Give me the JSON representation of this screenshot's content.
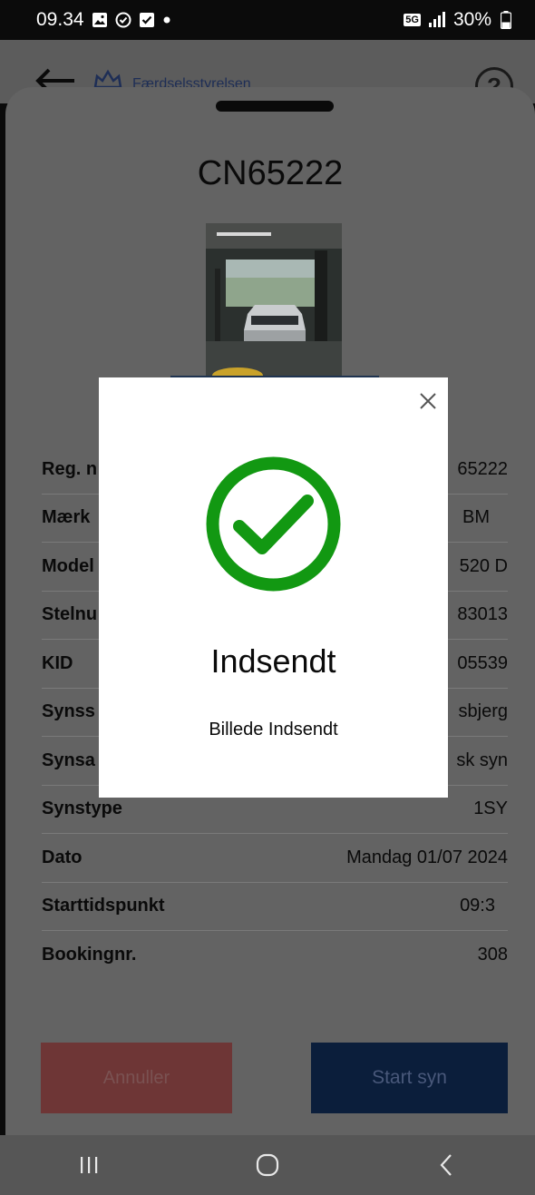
{
  "status_bar": {
    "time": "09.34",
    "network": "5G",
    "battery": "30%"
  },
  "header": {
    "agency": "Færdselsstyrelsen",
    "help": "?"
  },
  "vehicle": {
    "registration": "CN65222"
  },
  "details": [
    {
      "label": "Reg. n",
      "value": "65222"
    },
    {
      "label": "Mærk",
      "value": "BM"
    },
    {
      "label": "Model",
      "value": "520 D"
    },
    {
      "label": "Stelnu",
      "value": "83013"
    },
    {
      "label": "KID",
      "value": "05539"
    },
    {
      "label": "Synss",
      "value": "sbjerg"
    },
    {
      "label": "Synsa",
      "value": "sk syn"
    },
    {
      "label": "Synstype",
      "value": "1SY"
    },
    {
      "label": "Dato",
      "value": "Mandag 01/07 2024"
    },
    {
      "label": "Starttidspunkt",
      "value": "09:3"
    },
    {
      "label": "Bookingnr.",
      "value": "308"
    }
  ],
  "actions": {
    "cancel": "Annuller",
    "start": "Start syn"
  },
  "modal": {
    "title": "Indsendt",
    "message": "Billede Indsendt"
  },
  "colors": {
    "success": "#129812",
    "overlay_bg": "#636363",
    "cancel_bg": "#6e3636",
    "start_bg": "#0b1e3b"
  }
}
